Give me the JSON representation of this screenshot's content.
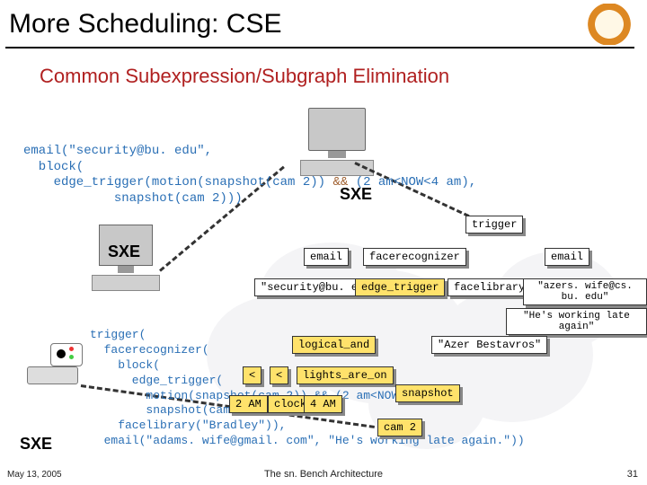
{
  "title": "More Scheduling: CSE",
  "subtitle": "Common Subexpression/Subgraph Elimination",
  "labels": {
    "sxe": "SXE"
  },
  "code": {
    "top_l1": "email(\"security@bu. edu\",",
    "top_l2": "  block(",
    "top_l3_a": "    edge_trigger(motion(snapshot(",
    "top_l3_cam": "cam 2",
    "top_l3_b": ")) ",
    "top_l3_amp": "&&",
    "top_l3_c": " (2 am<NOW<4 am),",
    "top_l4": "            snapshot(cam 2)))",
    "bot_l1": "trigger(",
    "bot_l2": "  facerecognizer(",
    "bot_l3": "    block(",
    "bot_l4": "      edge_trigger(",
    "bot_l5": "        motion(snapshot(cam 2)) && (2 am<NOW<4 am),",
    "bot_l6": "        snapshot(cam 2))),",
    "bot_l7": "    facelibrary(\"Bradley\")),",
    "bot_l8": "  email(\"adams. wife@gmail. com\", \"He's working late again.\"))"
  },
  "nodes": {
    "trigger": "trigger",
    "email_l": "email",
    "facerec": "facerecognizer",
    "email_r": "email",
    "sec_addr": "\"security@bu. edu\"",
    "edge_trigger": "edge_trigger",
    "facelib": "facelibrary",
    "wife_addr": "\"azers. wife@cs. bu. edu\"",
    "late_again": "\"He's working late again\"",
    "logical_and": "logical_and",
    "azer": "\"Azer Bestavros\"",
    "lt_l": "<",
    "lt_r": "<",
    "lights": "lights_are_on",
    "two_am": "2 AM",
    "clock": "clock",
    "four_am": "4 AM",
    "snapshot": "snapshot",
    "cam2": "cam 2"
  },
  "footer": {
    "left": "May 13, 2005",
    "center": "The sn. Bench Architecture",
    "right": "31"
  }
}
